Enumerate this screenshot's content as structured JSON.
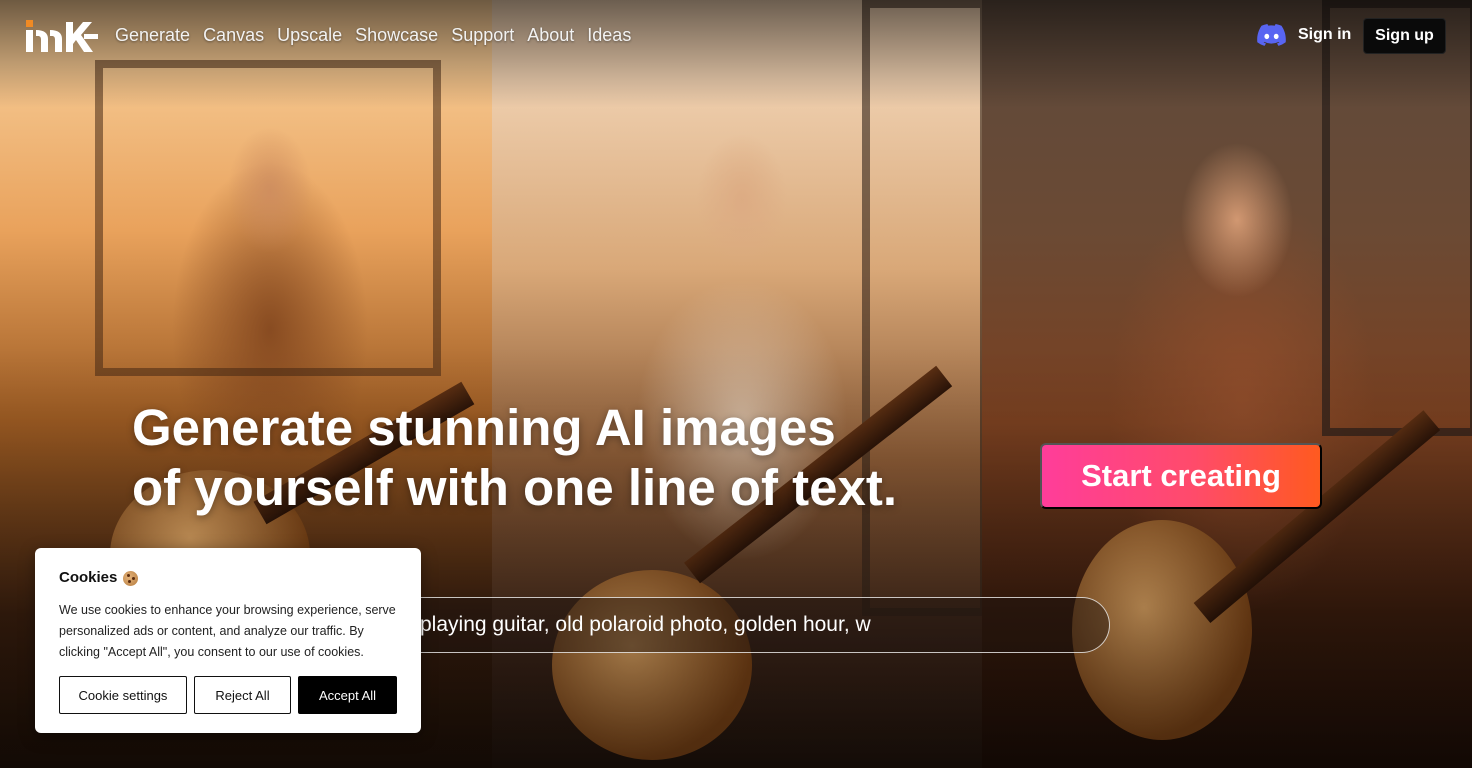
{
  "nav": {
    "logo_icon": "midjourney-style-logo",
    "links": [
      "Generate",
      "Canvas",
      "Upscale",
      "Showcase",
      "Support",
      "About",
      "Ideas"
    ],
    "discord_icon": "discord-icon",
    "sign_in": "Sign in",
    "sign_up": "Sign up"
  },
  "hero": {
    "headline_line1": "Generate stunning AI images",
    "headline_line2": "of yourself with one line of text.",
    "cta_label": "Start creating",
    "prompt_text": "playing guitar, old polaroid photo, golden hour, w"
  },
  "cookies": {
    "title": "Cookies",
    "icon": "cookie-icon",
    "body": "We use cookies to enhance your browsing experience, serve personalized ads or content, and analyze our traffic. By clicking \"Accept All\", you consent to our use of cookies.",
    "settings_label": "Cookie settings",
    "reject_label": "Reject All",
    "accept_label": "Accept All"
  },
  "colors": {
    "cta_gradient_start": "#ff3d9a",
    "cta_gradient_end": "#ff5a1f",
    "logo_accent": "#f08a24",
    "discord": "#5865f2"
  }
}
